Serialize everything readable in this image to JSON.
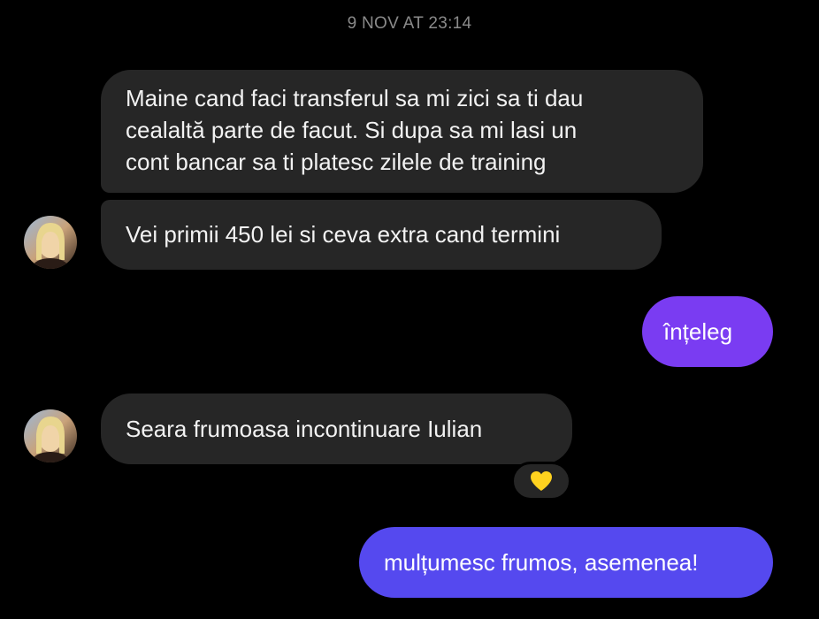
{
  "conversation": {
    "timestamp": "9 NOV AT 23:14",
    "messages": [
      {
        "direction": "incoming",
        "text": "Maine cand faci transferul sa mi zici sa ti dau\ncealaltă parte de facut. Si dupa sa mi lasi un\ncont bancar sa ti platesc zilele de training"
      },
      {
        "direction": "incoming",
        "text": "Vei primii 450 lei si ceva extra cand termini"
      },
      {
        "direction": "outgoing",
        "text": "înțeleg"
      },
      {
        "direction": "incoming",
        "text": "Seara frumoasa incontinuare  Iulian"
      },
      {
        "direction": "outgoing",
        "text": "mulțumesc frumos, asemenea!"
      }
    ],
    "reaction": {
      "icon": "yellow-heart-icon",
      "color": "#ffd21f"
    }
  },
  "colors": {
    "background": "#000000",
    "incoming_bubble": "#262626",
    "outgoing_bubble_purple": "#7a3cf2",
    "outgoing_bubble_blue": "#5549ef",
    "timestamp": "#8a8a8a"
  }
}
